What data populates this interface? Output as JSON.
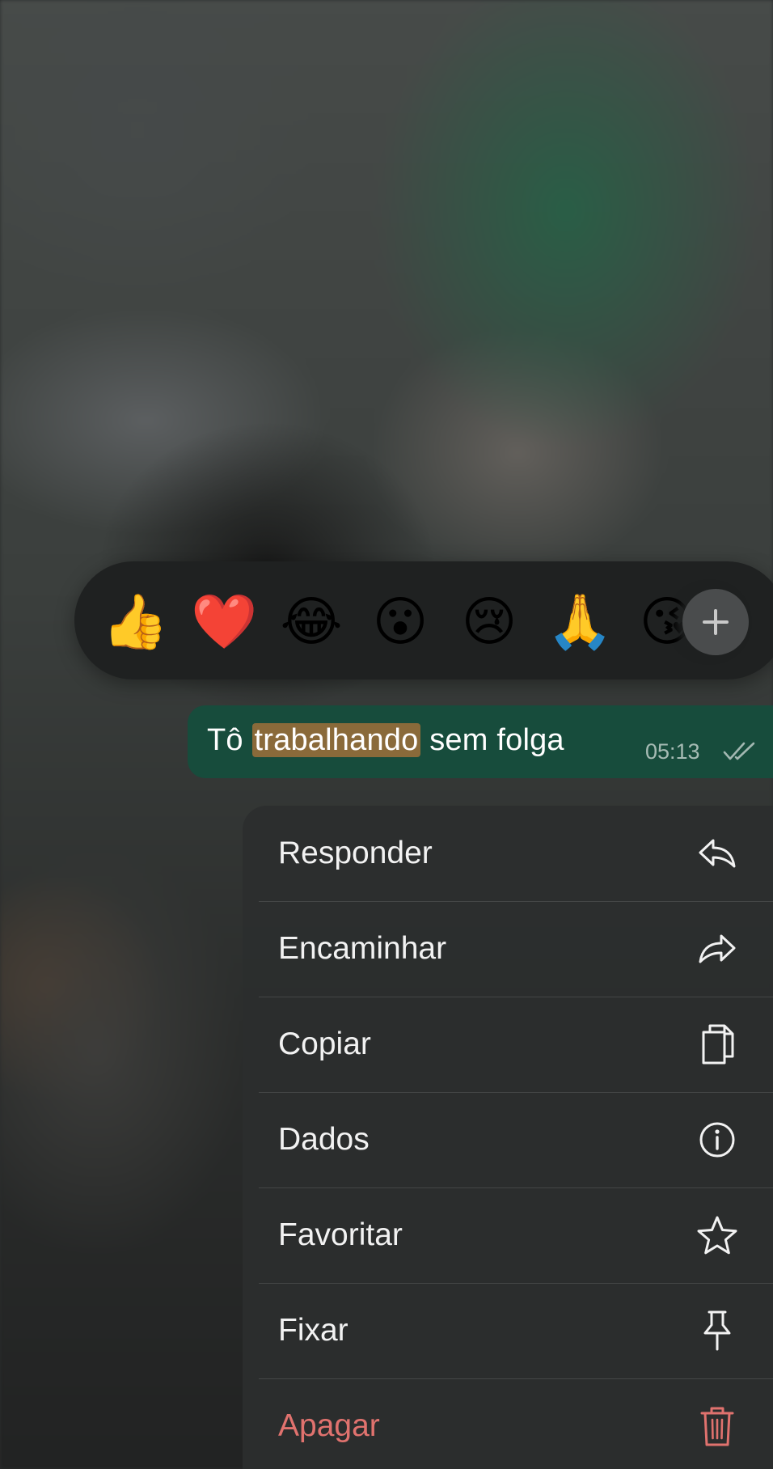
{
  "reactions": {
    "emojis": [
      {
        "name": "thumbs-up-emoji",
        "char": "👍"
      },
      {
        "name": "red-heart-emoji",
        "char": "❤️"
      },
      {
        "name": "joy-emoji",
        "char": "😂"
      },
      {
        "name": "surprised-face-emoji",
        "char": "😮"
      },
      {
        "name": "crying-face-emoji",
        "char": "😢"
      },
      {
        "name": "folded-hands-emoji",
        "char": "🙏"
      },
      {
        "name": "face-blowing-kiss-emoji",
        "char": "😘"
      }
    ],
    "more_icon": "plus-icon"
  },
  "message": {
    "text_before": "Tô ",
    "text_highlight": "trabalhando",
    "text_after": " sem folga",
    "time": "05:13",
    "status_icon": "double-check-icon",
    "bubble_color": "#174c3c",
    "highlight_color": "#8a6a3a"
  },
  "menu": {
    "items": [
      {
        "label": "Responder",
        "icon": "reply-icon"
      },
      {
        "label": "Encaminhar",
        "icon": "forward-icon"
      },
      {
        "label": "Copiar",
        "icon": "copy-icon"
      },
      {
        "label": "Dados",
        "icon": "info-icon"
      },
      {
        "label": "Favoritar",
        "icon": "star-icon"
      },
      {
        "label": "Fixar",
        "icon": "pin-icon"
      },
      {
        "label": "Apagar",
        "icon": "trash-icon"
      }
    ],
    "danger_color": "#e0726e"
  }
}
